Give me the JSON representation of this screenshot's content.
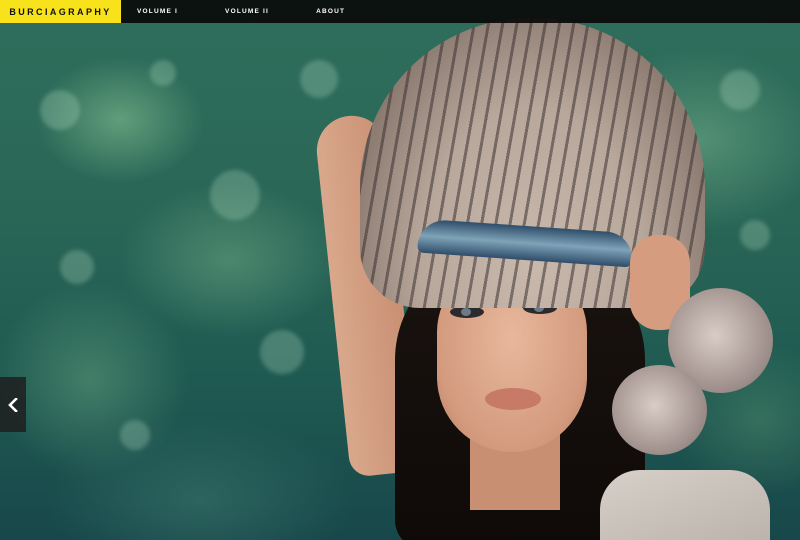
{
  "brand": {
    "name": "BURCIAGRAPHY",
    "color": "#f7e21b"
  },
  "nav": {
    "items": [
      {
        "label": "VOLUME I"
      },
      {
        "label": "VOLUME II"
      },
      {
        "label": "ABOUT"
      }
    ]
  },
  "slider": {
    "prev_icon": "chevron-left-icon"
  },
  "hero": {
    "image": "portrait-feather-headdress"
  }
}
